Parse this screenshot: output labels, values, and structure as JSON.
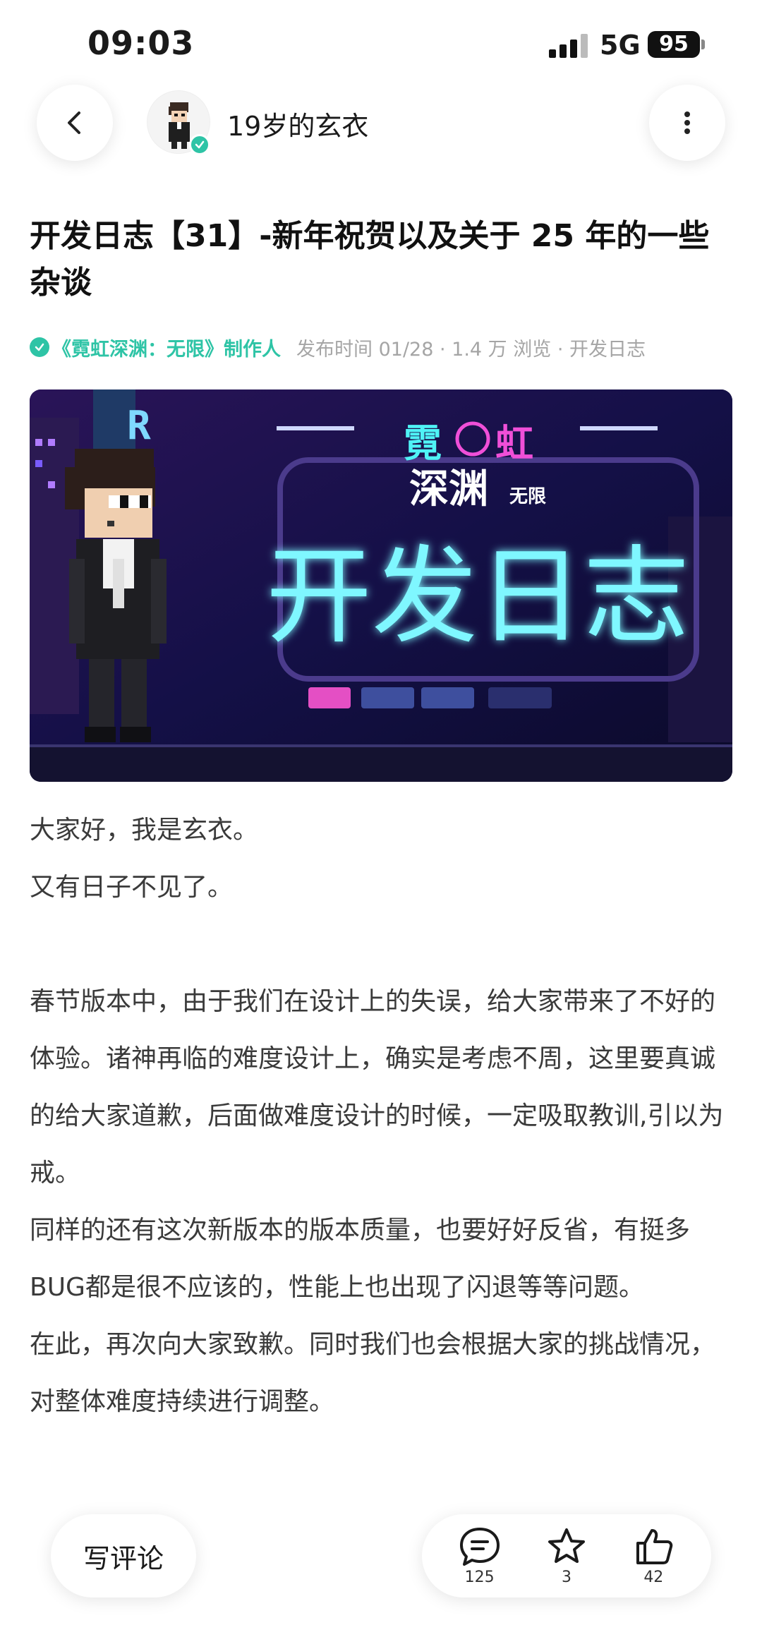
{
  "status": {
    "time": "09:03",
    "network": "5G",
    "battery": "95"
  },
  "header": {
    "author_name": "19岁的玄衣"
  },
  "article": {
    "title": "开发日志【31】-新年祝贺以及关于 25 年的一些杂谈",
    "tag": "《霓虹深渊：无限》制作人",
    "info": "发布时间 01/28 · 1.4 万 浏览 · 开发日志",
    "cover": {
      "logo_line1_a": "霓",
      "logo_line1_b": "虹",
      "logo_line2": "深渊",
      "logo_sub": "无限",
      "headline": "开发日志"
    },
    "paragraphs": [
      "大家好，我是玄衣。",
      "又有日子不见了。",
      "",
      "春节版本中，由于我们在设计上的失误，给大家带来了不好的体验。诸神再临的难度设计上，确实是考虑不周，这里要真诚的给大家道歉，后面做难度设计的时候，一定吸取教训,引以为戒。",
      "同样的还有这次新版本的版本质量，也要好好反省，有挺多BUG都是很不应该的，性能上也出现了闪退等等问题。",
      "在此，再次向大家致歉。同时我们也会根据大家的挑战情况，对整体难度持续进行调整。"
    ]
  },
  "bottom": {
    "comment_label": "写评论",
    "comments": "125",
    "favorites": "3",
    "likes": "42"
  },
  "colors": {
    "accent": "#2ec4a6",
    "neon_cyan": "#4ff3f6",
    "neon_pink": "#f04fd8"
  }
}
